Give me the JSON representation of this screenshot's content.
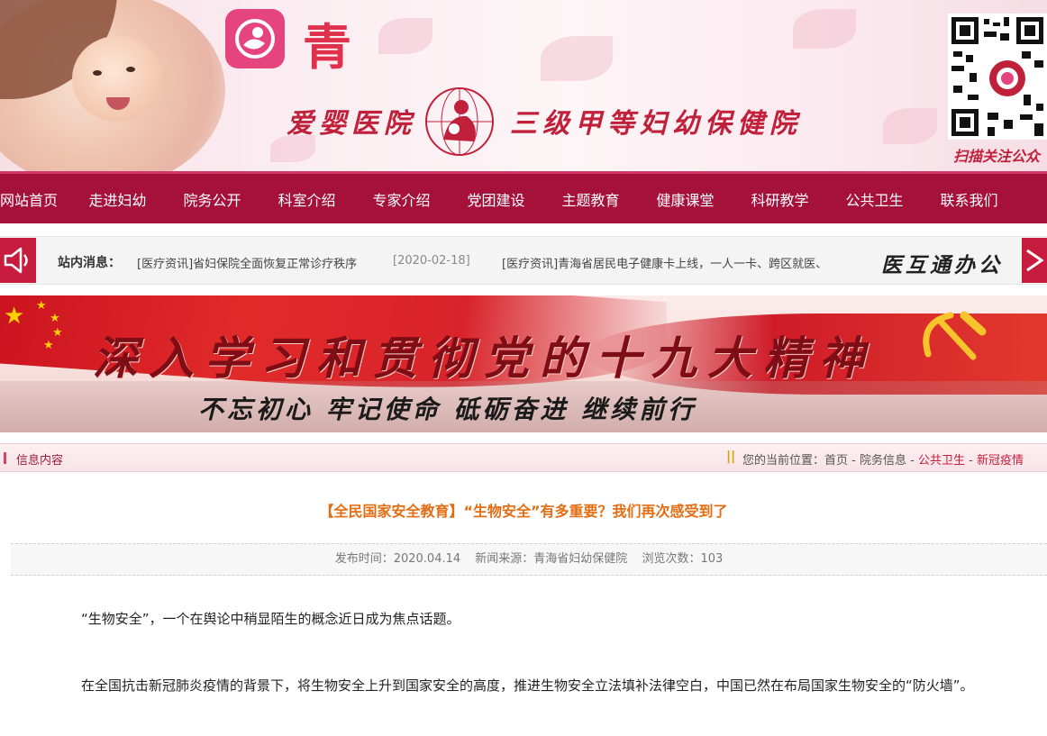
{
  "header": {
    "logo_char": "青",
    "hospital_name_left": "爱婴医院",
    "hospital_name_right": "三级甲等妇幼保健院",
    "qr_caption": "扫描关注公众"
  },
  "nav": {
    "items": [
      "网站首页",
      "走进妇幼",
      "院务公开",
      "科室介绍",
      "专家介绍",
      "党团建设",
      "主题教育",
      "健康课堂",
      "科研教学",
      "公共卫生",
      "联系我们"
    ]
  },
  "ticker": {
    "label": "站内消息：",
    "items": [
      {
        "text": "[医疗资讯]省妇保院全面恢复正常诊疗秩序",
        "date": "[2020-02-18]"
      },
      {
        "text": "[医疗资讯]青海省居民电子健康卡上线，一人一卡、跨区就医、"
      }
    ],
    "right_label": "医互通办公"
  },
  "banner": {
    "title": "深入学习和贯彻党的十九大精神",
    "subtitle": "不忘初心 牢记使命 砥砺奋进 继续前行"
  },
  "breadcrumb": {
    "section_title": "信息内容",
    "prefix": "您的当前位置：",
    "home": "首页",
    "sep": " - ",
    "level1": "院务信息",
    "level2": "公共卫生",
    "level3": "新冠疫情"
  },
  "article": {
    "title": "【全民国家安全教育】“生物安全”有多重要？我们再次感受到了",
    "publish_time": "发布时间：2020.04.14",
    "source": "新闻来源：青海省妇幼保健院",
    "views": "浏览次数：103",
    "paragraphs": [
      "“生物安全”，一个在舆论中稍显陌生的概念近日成为焦点话题。",
      "在全国抗击新冠肺炎疫情的背景下，将生物安全上升到国家安全的高度，推进生物安全立法填补法律空白，中国已然在布局国家生物安全的“防火墙”。"
    ]
  },
  "colors": {
    "nav_bg": "#a5113a",
    "accent_red": "#c81c3e",
    "title_orange": "#e36d13"
  }
}
